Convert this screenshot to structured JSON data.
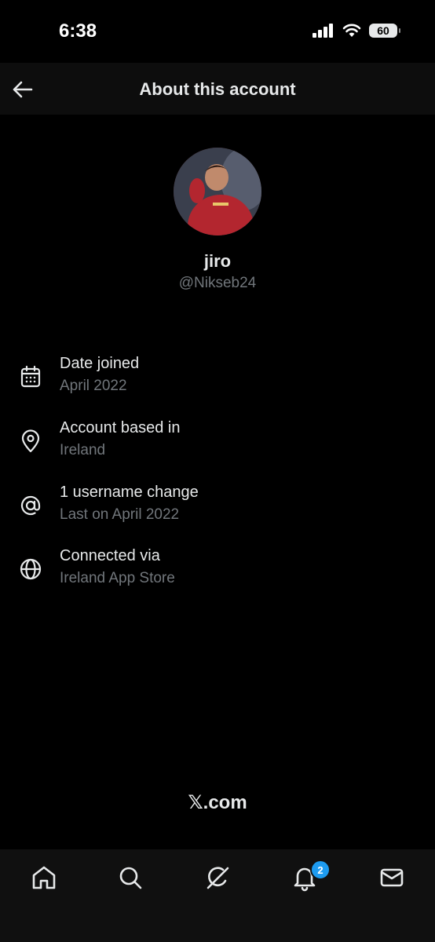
{
  "status_bar": {
    "time": "6:38",
    "battery": "60"
  },
  "header": {
    "title": "About this account"
  },
  "profile": {
    "display_name": "jiro",
    "handle": "@Nikseb24"
  },
  "info": [
    {
      "icon": "calendar-icon",
      "title": "Date joined",
      "subtitle": "April 2022"
    },
    {
      "icon": "location-pin-icon",
      "title": "Account based in",
      "subtitle": "Ireland"
    },
    {
      "icon": "at-sign-icon",
      "title": "1 username change",
      "subtitle": "Last on April 2022"
    },
    {
      "icon": "globe-icon",
      "title": "Connected via",
      "subtitle": "Ireland App Store"
    }
  ],
  "footer": {
    "logo_text": "𝕏.com"
  },
  "tab_bar": {
    "notifications_badge": "2"
  },
  "colors": {
    "background": "#000000",
    "text_primary": "#e7e9ea",
    "text_secondary": "#71767b",
    "accent": "#1d9bf0"
  }
}
